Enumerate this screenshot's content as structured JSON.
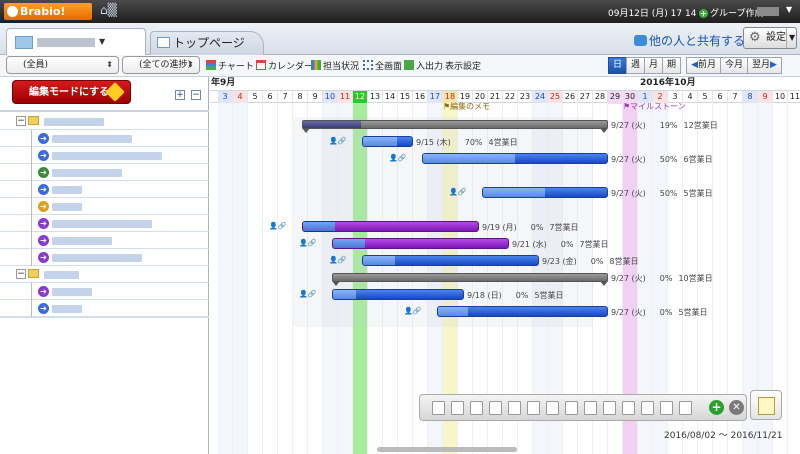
{
  "topbar": {
    "logo": "Brabio!",
    "date": "09月12日 (月) 17 14",
    "group_create": "グループ作成"
  },
  "tabs": {
    "top_page": "トップページ"
  },
  "share": {
    "label": "他の人と共有する"
  },
  "settings": {
    "label": "設定"
  },
  "toolbar": {
    "member_select": "(全員)",
    "progress_select": "(全ての進捗)",
    "chart": "チャート",
    "calendar": "カレンダー",
    "assignee": "担当状況",
    "fullscreen": "全画面",
    "io": "入出力",
    "display": "表示設定"
  },
  "view": {
    "day": "日",
    "week": "週",
    "month": "月",
    "period": "期",
    "prev": "前月",
    "today": "今月",
    "next": "翌月"
  },
  "left": {
    "edit_mode": "編集モードにする"
  },
  "gantt": {
    "month1": "年9月",
    "month2": "2016年10月",
    "days": [
      "3",
      "4",
      "5",
      "6",
      "7",
      "8",
      "9",
      "10",
      "11",
      "12",
      "13",
      "14",
      "15",
      "16",
      "17",
      "18",
      "19",
      "20",
      "21",
      "22",
      "23",
      "24",
      "25",
      "26",
      "27",
      "28",
      "29",
      "30",
      "1",
      "2",
      "3",
      "4",
      "5",
      "6",
      "7",
      "8",
      "9",
      "10",
      "11"
    ],
    "events": {
      "edit_meeting": "編集のメモ",
      "milestone": "マイルストーン"
    },
    "tasks": [
      {
        "end": "9/27 (火)",
        "pct": "19%",
        "days": "12営業日"
      },
      {
        "end": "9/15 (木)",
        "pct": "70%",
        "days": "4営業日"
      },
      {
        "end": "9/27 (火)",
        "pct": "50%",
        "days": "6営業日"
      },
      {
        "end": "9/27 (火)",
        "pct": "50%",
        "days": "5営業日"
      },
      {
        "end": "9/19 (月)",
        "pct": "0%",
        "days": "7営業日"
      },
      {
        "end": "9/21 (水)",
        "pct": "0%",
        "days": "7営業日"
      },
      {
        "end": "9/23 (金)",
        "pct": "0%",
        "days": "8営業日"
      },
      {
        "end": "9/27 (火)",
        "pct": "0%",
        "days": "10営業日"
      },
      {
        "end": "9/18 (日)",
        "pct": "0%",
        "days": "5営業日"
      },
      {
        "end": "9/27 (火)",
        "pct": "0%",
        "days": "5営業日"
      }
    ],
    "range": "2016/08/02 〜 2016/11/21"
  },
  "colors": {
    "accent": "#1c50a8",
    "edit_red": "#c81010",
    "today_green": "#22cc22",
    "milestone_pink": "#e6b4ee",
    "event_yellow": "#f4f2b4"
  }
}
